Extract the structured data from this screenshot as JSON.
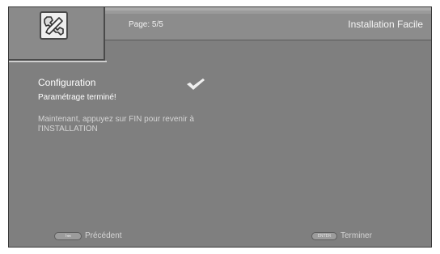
{
  "header": {
    "page_indicator": "Page: 5/5",
    "menu_title": "Installation Facile",
    "icon": "wrench-icon"
  },
  "content": {
    "section_title": "Configuration",
    "check_icon": "checkmark-icon",
    "status": "Paramétrage terminé!",
    "instruction": "Maintenant, appuyez sur FIN pour revenir à l'INSTALLATION"
  },
  "footer": {
    "previous": {
      "key_label": "I◂◂",
      "label": "Précédent"
    },
    "finish": {
      "key_label": "ENTER",
      "label": "Terminer"
    }
  },
  "colors": {
    "screen_background": "#7f7f7f",
    "header_background": "#8c8c8c",
    "text_primary": "#ffffff",
    "text_secondary": "#d4d4d4"
  }
}
